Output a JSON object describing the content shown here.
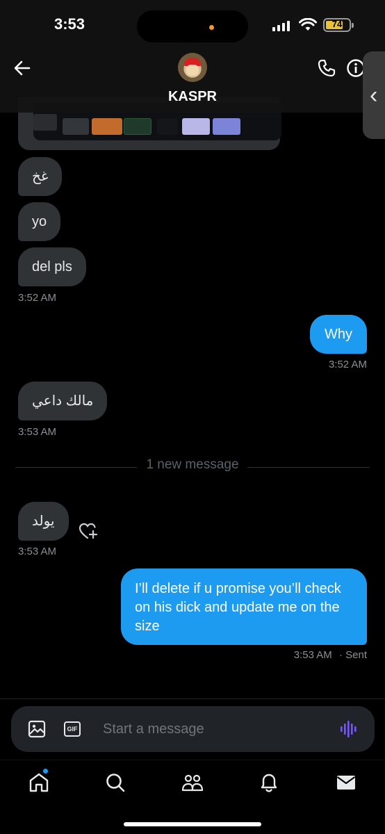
{
  "status_bar": {
    "time": "3:53",
    "battery": "74"
  },
  "header": {
    "username": "KASPR"
  },
  "messages": {
    "m1": "غخ",
    "m2": "yo",
    "m3": "del pls",
    "m3_time": "3:52 AM",
    "m4": "Why",
    "m4_time": "3:52 AM",
    "m5": "مالك داعي",
    "m5_time": "3:53 AM",
    "new_divider": "1 new message",
    "m6": "يولد",
    "m6_time": "3:53 AM",
    "m7": "I’ll delete if u promise you’ll check on his dick and update me on the size",
    "m7_time": "3:53 AM",
    "m7_status": "· Sent"
  },
  "composer": {
    "placeholder": "Start a message",
    "gif_label": "GIF"
  },
  "colors": {
    "accent": "#1d9bf0",
    "incoming": "#2f3336",
    "background": "#000000",
    "voice": "#7856ff"
  },
  "icons": [
    "back-arrow-icon",
    "phone-icon",
    "info-icon",
    "image-icon",
    "gif-icon",
    "voice-icon",
    "home-icon",
    "search-icon",
    "communities-icon",
    "notifications-icon",
    "messages-icon",
    "heart-plus-icon"
  ]
}
